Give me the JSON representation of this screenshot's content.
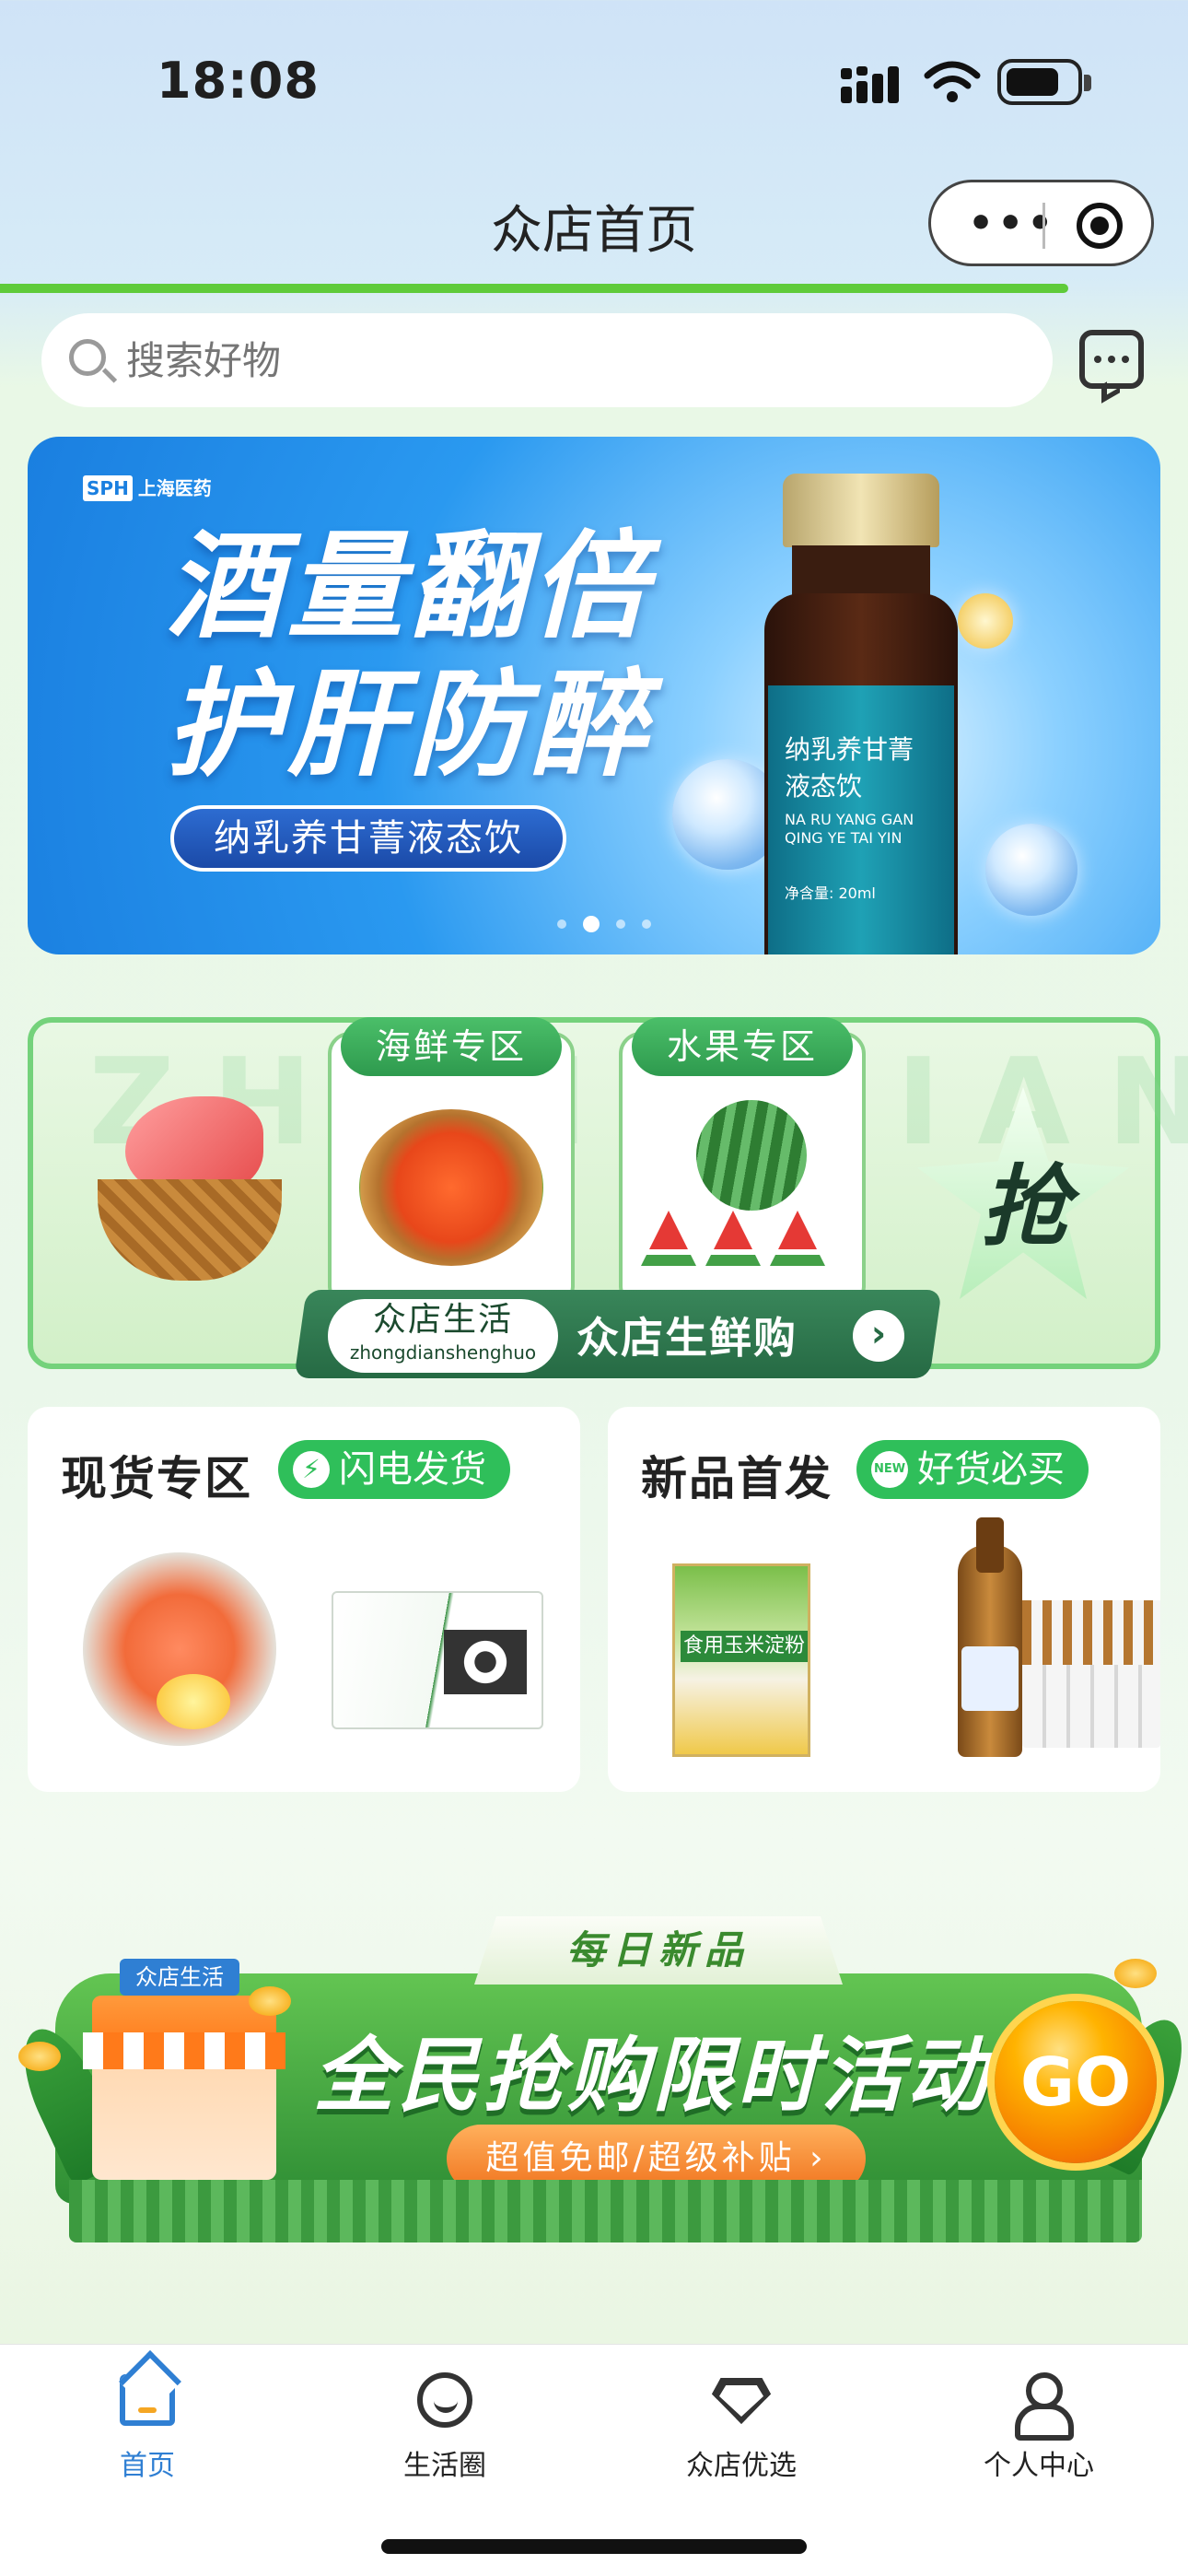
{
  "status": {
    "time": "18:08"
  },
  "nav": {
    "title": "众店首页",
    "more_icon": "more-dots-icon",
    "close_icon": "target-circle-icon"
  },
  "search": {
    "placeholder": "搜索好物",
    "message_icon": "chat-bubble-icon"
  },
  "banner": {
    "brand": "上海医药",
    "brand_logo": "SPH",
    "headline_1": "酒量翻倍",
    "headline_2": "护肝防醉",
    "product_pill": "纳乳养甘菁液态饮",
    "bottle_label": "纳乳养甘菁液态饮",
    "bottle_pinyin": "NA RU YANG GAN QING YE TAI YIN",
    "bottle_volume": "净含量: 20ml",
    "slide_count": 4,
    "active_slide": 1
  },
  "fresh": {
    "watermark": "ZHONGDIAN",
    "seafood_tag": "海鲜专区",
    "fruit_tag": "水果专区",
    "grab_label": "抢",
    "store_name": "众店生活",
    "store_pinyin": "zhongdianshenghuo",
    "title": "众店生鲜购",
    "go_arrow": "›"
  },
  "cards": [
    {
      "title": "现货专区",
      "badge": "闪电发货",
      "badge_icon": "lightning-icon"
    },
    {
      "title": "新品首发",
      "badge": "好货必买",
      "badge_icon": "new-icon",
      "corn_label": "食用玉米淀粉"
    }
  ],
  "activity": {
    "tag": "每日新品",
    "headline": "全民抢购限时活动",
    "sub": "超值免邮/超级补贴",
    "go": "GO",
    "shop_sign": "众店生活"
  },
  "tabs": [
    {
      "label": "首页",
      "icon": "home-icon",
      "active": true
    },
    {
      "label": "生活圈",
      "icon": "chat-circle-icon",
      "active": false
    },
    {
      "label": "众店优选",
      "icon": "diamond-icon",
      "active": false
    },
    {
      "label": "个人中心",
      "icon": "user-icon",
      "active": false
    }
  ],
  "colors": {
    "accent": "#2f7fd3",
    "green": "#2fbf5a",
    "progress": "#5fcb3a"
  }
}
